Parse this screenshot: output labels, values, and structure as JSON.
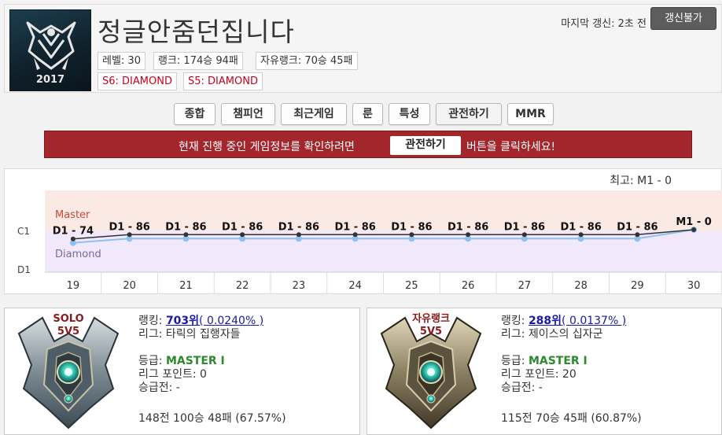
{
  "profile": {
    "name": "정글안줌던집니다",
    "year_badge": "2017",
    "level": "레벨: 30",
    "rank_record": "랭크: 174승 94패",
    "flex_record": "자유랭크: 70승 45패",
    "season6": "S6: DIAMOND",
    "season5": "S5: DIAMOND",
    "last_update": "마지막 갱신: 2초 전",
    "update_button": "갱신불가"
  },
  "tabs": [
    "종합",
    "챔피언",
    "최근게임",
    "룬",
    "특성",
    "관전하기",
    "MMR"
  ],
  "banner": {
    "text_before": "현재 진행 중인 게임정보를 확인하려면",
    "button": "관전하기",
    "text_after": "버튼을 클릭하세요!"
  },
  "chart_data": {
    "type": "line",
    "peak_label": "최고: M1 - 0",
    "band_labels": [
      "Master",
      "Diamond"
    ],
    "y_tick_labels": [
      "C1",
      "D1"
    ],
    "x": [
      "19",
      "20",
      "21",
      "22",
      "23",
      "24",
      "25",
      "26",
      "27",
      "28",
      "29",
      "30"
    ],
    "series": [
      {
        "labels": [
          "D1 - 74",
          "D1 - 86",
          "D1 - 86",
          "D1 - 86",
          "D1 - 86",
          "D1 - 86",
          "D1 - 86",
          "D1 - 86",
          "D1 - 86",
          "D1 - 86",
          "D1 - 86",
          "M1 - 0"
        ],
        "values": [
          74,
          86,
          86,
          86,
          86,
          86,
          86,
          86,
          86,
          86,
          86,
          100
        ]
      }
    ],
    "colors": {
      "line": "#333333",
      "mmr_line": "#90c0f0",
      "master_band": "#fbe9e3",
      "diamond_band": "#f1e9fb"
    }
  },
  "ranked": [
    {
      "queue": "SOLO",
      "queue_sub": "5V5",
      "ranking_label": "랭킹:",
      "ranking": "703위",
      "ranking_pct": "( 0.0240% )",
      "league": "리그: 타릭의 집행자들",
      "tier_label": "등급:",
      "tier": "MASTER I",
      "lp": "리그 포인트: 0",
      "promo": "승급전: -",
      "record": "148전 100승 48패 (67.57%)"
    },
    {
      "queue": "자유랭크",
      "queue_sub": "5V5",
      "ranking_label": "랭킹:",
      "ranking": "288위",
      "ranking_pct": "( 0.0137% )",
      "league": "리그: 제이스의 십자군",
      "tier_label": "등급:",
      "tier": "MASTER I",
      "lp": "리그 포인트: 20",
      "promo": "승급전: -",
      "record": "115전 70승 45패 (60.87%)"
    }
  ]
}
